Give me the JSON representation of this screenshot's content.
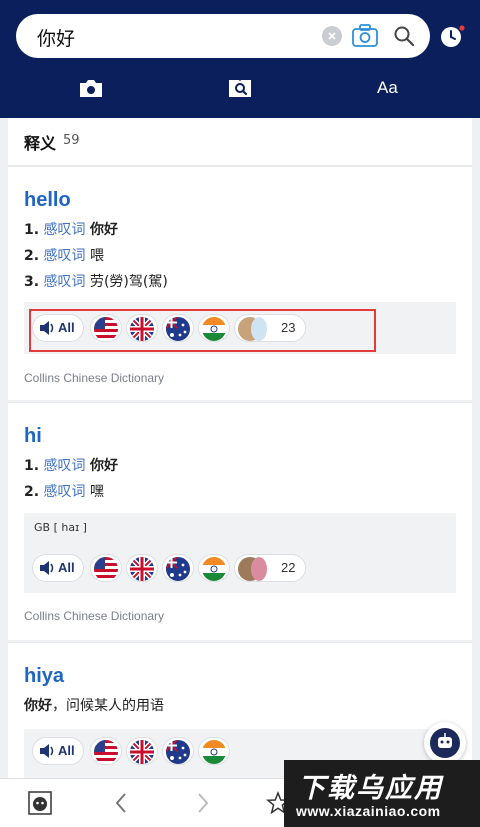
{
  "search": {
    "query": "你好"
  },
  "tabs": [
    {
      "icon": "camera-icon"
    },
    {
      "icon": "book-search-icon"
    },
    {
      "label": "Aa"
    }
  ],
  "summary": {
    "label": "释义",
    "count": "59"
  },
  "entries": [
    {
      "headword": "hello",
      "senses": [
        {
          "num": "1.",
          "pos": "感叹词",
          "text": "你好",
          "bold": true
        },
        {
          "num": "2.",
          "pos": "感叹词",
          "text": "喂",
          "bold": false
        },
        {
          "num": "3.",
          "pos": "感叹词",
          "text": "劳(勞)驾(駕)",
          "bold": false
        }
      ],
      "audio": {
        "all_label": "All",
        "flags": [
          "us-flag",
          "uk-flag",
          "au-flag",
          "in-flag"
        ],
        "more_count": "23"
      },
      "source": "Collins Chinese Dictionary"
    },
    {
      "headword": "hi",
      "senses": [
        {
          "num": "1.",
          "pos": "感叹词",
          "text": "你好",
          "bold": true
        },
        {
          "num": "2.",
          "pos": "感叹词",
          "text": "嘿",
          "bold": false
        }
      ],
      "phonetic": "GB [ haɪ ]",
      "audio": {
        "all_label": "All",
        "flags": [
          "us-flag",
          "uk-flag",
          "au-flag",
          "in-flag"
        ],
        "more_count": "22"
      },
      "source": "Collins Chinese Dictionary"
    },
    {
      "headword": "hiya",
      "definition": {
        "em": "你好",
        "rest": "，问候某人的用语"
      },
      "audio": {
        "all_label": "All",
        "flags": [
          "us-flag",
          "uk-flag",
          "au-flag",
          "in-flag"
        ]
      }
    }
  ],
  "watermark": {
    "title": "下载乌应用",
    "subtitle": "www.xiazainiao.com"
  },
  "colors": {
    "header": "#0b1f5c",
    "headword": "#1f66c4",
    "pos": "#3f72c4",
    "highlight": "#e23b3b"
  }
}
